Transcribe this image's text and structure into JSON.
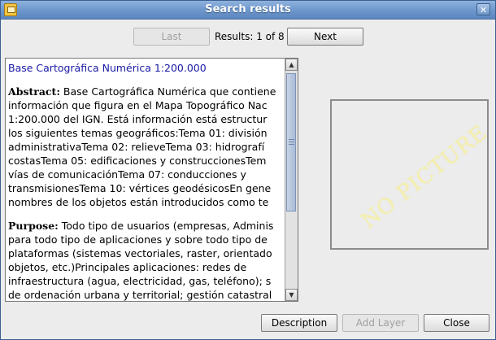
{
  "window": {
    "title": "Search results",
    "close_glyph": "✕"
  },
  "nav": {
    "last_label": "Last",
    "results_prefix": "Results:",
    "results_value": "1 of 8",
    "next_label": "Next"
  },
  "document": {
    "title": "Base Cartográfica Numérica 1:200.000",
    "abstract_label": "Abstract:",
    "abstract_lines": [
      " Base Cartográfica Numérica que contiene",
      "información que figura en el Mapa Topográfico Nac",
      "1:200.000 del IGN. Está información está estructur",
      "los siguientes temas geográficos:Tema 01: división",
      "administrativaTema 02: relieveTema 03: hidrografí",
      "costasTema 05: edificaciones y construccionesTem",
      "vías de comunicaciónTema 07: conducciones y",
      "transmisionesTema 10: vértices geodésicosEn gene",
      "nombres de los objetos están introducidos como te"
    ],
    "purpose_label": "Purpose:",
    "purpose_lines": [
      " Todo tipo de usuarios (empresas, Adminis",
      "para todo tipo de aplicaciones y sobre todo tipo de",
      "plataformas (sistemas vectoriales, raster, orientado",
      "objetos, etc.)Principales aplicaciones: redes de",
      "infraestructura (agua, electricidad, gas, teléfono); s",
      "de ordenación urbana y territorial; gestión catastral"
    ]
  },
  "picture": {
    "placeholder_text": "NO PICTURE"
  },
  "footer": {
    "description_label": "Description",
    "add_layer_label": "Add Layer",
    "close_label": "Close"
  },
  "icons": {
    "window_icon": "app-window-icon",
    "close": "close-icon",
    "scroll_up": "arrow-up-icon",
    "scroll_down": "arrow-down-icon"
  }
}
